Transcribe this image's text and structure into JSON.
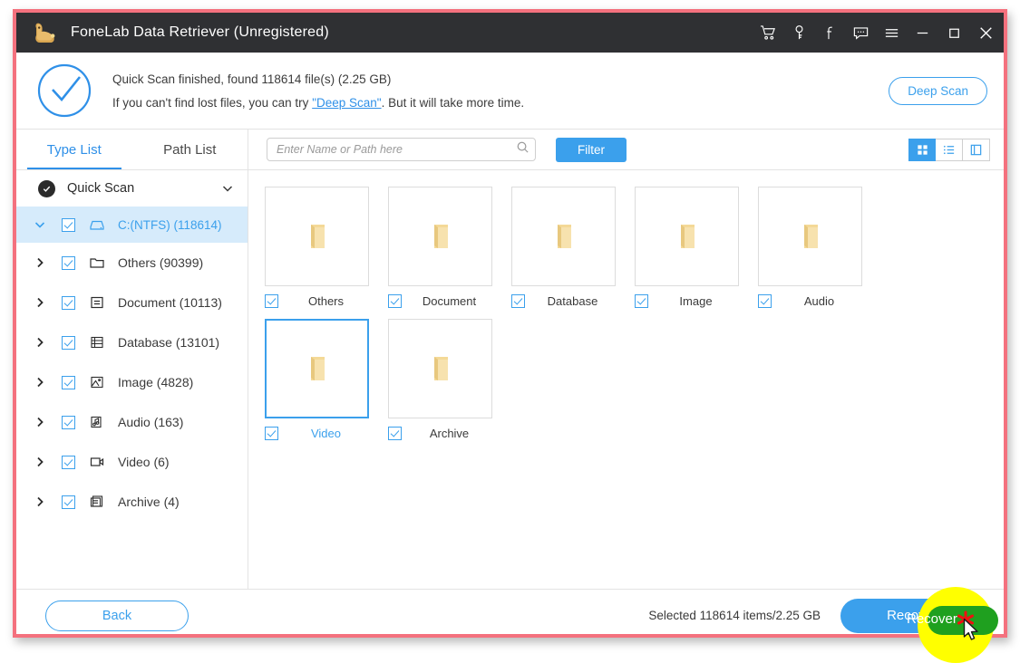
{
  "window": {
    "title": "FoneLab Data Retriever (Unregistered)",
    "border_color": "#f4717e",
    "titlebar_bg": "#2f3033",
    "accent_color": "#3ba0ec"
  },
  "titlebar_icons": [
    {
      "name": "cart-icon",
      "label": "Cart"
    },
    {
      "name": "key-icon",
      "label": "Key"
    },
    {
      "name": "facebook-icon",
      "label": "Facebook"
    },
    {
      "name": "feedback-icon",
      "label": "Feedback"
    },
    {
      "name": "menu-icon",
      "label": "Menu"
    },
    {
      "name": "minimize-icon",
      "label": "Minimize"
    },
    {
      "name": "maximize-icon",
      "label": "Maximize"
    },
    {
      "name": "close-icon",
      "label": "Close"
    }
  ],
  "status": {
    "line1": "Quick Scan finished, found 118614 file(s) (2.25 GB)",
    "line2_prefix": "If you can't find lost files, you can try ",
    "line2_link": "\"Deep Scan\"",
    "line2_suffix": ". But it will take more time.",
    "deep_scan_button": "Deep Scan"
  },
  "sidebar": {
    "tabs": [
      {
        "label": "Type List",
        "active": true
      },
      {
        "label": "Path List",
        "active": false
      }
    ],
    "scan_selector": {
      "label": "Quick Scan",
      "icon": "check-circle-icon",
      "chevron": "chevron-down-icon"
    },
    "root": {
      "label": "C:(NTFS) (118614)",
      "checked": true,
      "expanded": true,
      "icon": "drive-icon"
    },
    "items": [
      {
        "label": "Others (90399)",
        "icon": "folder-icon",
        "checked": true
      },
      {
        "label": "Document (10113)",
        "icon": "document-icon",
        "checked": true
      },
      {
        "label": "Database (13101)",
        "icon": "database-icon",
        "checked": true
      },
      {
        "label": "Image (4828)",
        "icon": "image-icon",
        "checked": true
      },
      {
        "label": "Audio (163)",
        "icon": "audio-icon",
        "checked": true
      },
      {
        "label": "Video (6)",
        "icon": "video-icon",
        "checked": true
      },
      {
        "label": "Archive (4)",
        "icon": "archive-icon",
        "checked": true
      }
    ]
  },
  "toolbar": {
    "search_placeholder": "Enter Name or Path here",
    "search_value": "",
    "search_icon": "search-icon",
    "filter_label": "Filter",
    "views": [
      {
        "name": "grid-view",
        "active": true
      },
      {
        "name": "list-view",
        "active": false
      },
      {
        "name": "split-view",
        "active": false
      }
    ]
  },
  "tiles": [
    {
      "label": "Others",
      "checked": true,
      "selected": false
    },
    {
      "label": "Document",
      "checked": true,
      "selected": false
    },
    {
      "label": "Database",
      "checked": true,
      "selected": false
    },
    {
      "label": "Image",
      "checked": true,
      "selected": false
    },
    {
      "label": "Audio",
      "checked": true,
      "selected": false
    },
    {
      "label": "Video",
      "checked": true,
      "selected": true
    },
    {
      "label": "Archive",
      "checked": true,
      "selected": false
    }
  ],
  "footer": {
    "back_label": "Back",
    "selected_info": "Selected 118614 items/2.25 GB",
    "recover_label": "Recover"
  }
}
